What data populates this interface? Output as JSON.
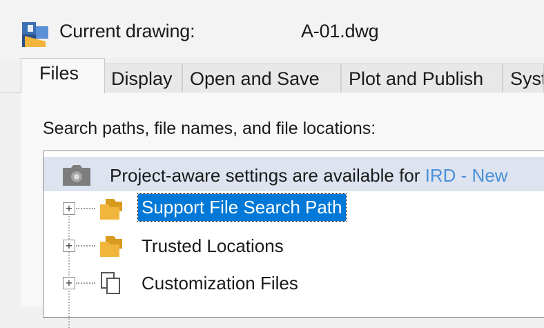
{
  "header": {
    "label": "Current drawing:",
    "filename": "A-01.dwg",
    "icon": "autocad-app-icon"
  },
  "tabs": [
    {
      "label": "Files",
      "active": true
    },
    {
      "label": "Display",
      "active": false
    },
    {
      "label": "Open and Save",
      "active": false
    },
    {
      "label": "Plot and Publish",
      "active": false
    },
    {
      "label": "Syst",
      "active": false
    }
  ],
  "section": {
    "label": "Search paths, file names, and file locations:"
  },
  "banner": {
    "text": "Project-aware settings are available for ",
    "link": "IRD - New",
    "icon": "project-camera-icon"
  },
  "tree_items": [
    {
      "label": "Support File Search Path",
      "icon": "folder-icon",
      "expander": "+",
      "selected": true
    },
    {
      "label": "Trusted Locations",
      "icon": "folder-icon",
      "expander": "+",
      "selected": false
    },
    {
      "label": "Customization Files",
      "icon": "copy-files-icon",
      "expander": "+",
      "selected": false
    }
  ],
  "colors": {
    "selection": "#0078d7",
    "banner_bg": "#dde4f0",
    "link": "#4a8fd8",
    "folder": "#f0b53a"
  }
}
